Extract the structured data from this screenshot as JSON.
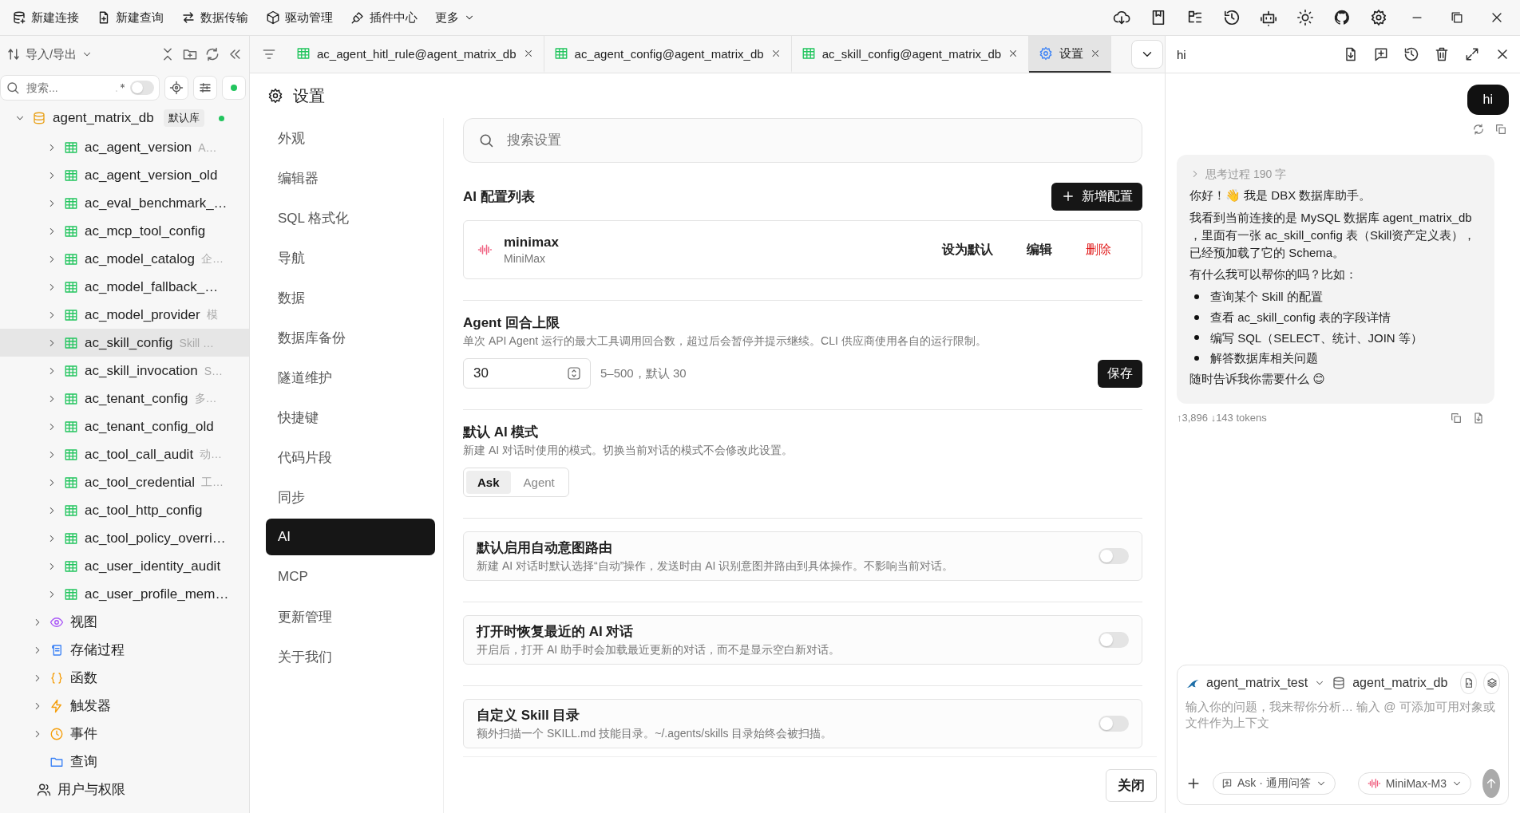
{
  "toolbar": {
    "actions": [
      {
        "label": "新建连接"
      },
      {
        "label": "新建查询"
      },
      {
        "label": "数据传输"
      },
      {
        "label": "驱动管理"
      },
      {
        "label": "插件中心"
      }
    ],
    "more": "更多"
  },
  "sidebar": {
    "import_export": "导入/导出",
    "search": {
      "placeholder": "搜索...",
      "regex_on": false
    },
    "tree": [
      {
        "label": "agent_matrix_db",
        "kind": "database",
        "badge": "默认库",
        "online": true,
        "expanded": true,
        "tables": [
          {
            "label": "ac_agent_version",
            "comment": "A…",
            "selected": false
          },
          {
            "label": "ac_agent_version_old",
            "selected": false
          },
          {
            "label": "ac_eval_benchmark_…",
            "selected": false
          },
          {
            "label": "ac_mcp_tool_config",
            "selected": false
          },
          {
            "label": "ac_model_catalog",
            "comment": "企…",
            "selected": false
          },
          {
            "label": "ac_model_fallback_…",
            "selected": false
          },
          {
            "label": "ac_model_provider",
            "comment": "模",
            "selected": false
          },
          {
            "label": "ac_skill_config",
            "comment": "Skill …",
            "selected": true
          },
          {
            "label": "ac_skill_invocation",
            "comment": "S…",
            "selected": false
          },
          {
            "label": "ac_tenant_config",
            "comment": "多…",
            "selected": false
          },
          {
            "label": "ac_tenant_config_old",
            "selected": false
          },
          {
            "label": "ac_tool_call_audit",
            "comment": "动…",
            "selected": false
          },
          {
            "label": "ac_tool_credential",
            "comment": "工…",
            "selected": false
          },
          {
            "label": "ac_tool_http_config",
            "selected": false
          },
          {
            "label": "ac_tool_policy_overri…",
            "selected": false
          },
          {
            "label": "ac_user_identity_audit",
            "selected": false
          },
          {
            "label": "ac_user_profile_mem…",
            "selected": false
          }
        ],
        "children": [
          {
            "label": "视图",
            "kind": "view",
            "expanded": false
          },
          {
            "label": "存储过程",
            "kind": "procedure",
            "expanded": false
          },
          {
            "label": "函数",
            "kind": "function",
            "expanded": false
          },
          {
            "label": "触发器",
            "kind": "trigger",
            "expanded": false
          },
          {
            "label": "事件",
            "kind": "event",
            "expanded": false
          },
          {
            "label": "查询",
            "kind": "folder"
          }
        ]
      },
      {
        "label": "用户与权限",
        "kind": "users"
      }
    ]
  },
  "tabs": [
    {
      "label": "ac_agent_hitl_rule@agent_matrix_db",
      "kind": "table",
      "selected": false
    },
    {
      "label": "ac_agent_config@agent_matrix_db",
      "kind": "table",
      "selected": false
    },
    {
      "label": "ac_skill_config@agent_matrix_db",
      "kind": "table",
      "selected": false
    },
    {
      "label": "设置",
      "kind": "settings",
      "selected": true
    }
  ],
  "settings": {
    "title": "设置",
    "nav": [
      {
        "label": "外观",
        "selected": false
      },
      {
        "label": "编辑器",
        "selected": false
      },
      {
        "label": "SQL 格式化",
        "selected": false
      },
      {
        "label": "导航",
        "selected": false
      },
      {
        "label": "数据",
        "selected": false
      },
      {
        "label": "数据库备份",
        "selected": false
      },
      {
        "label": "隧道维护",
        "selected": false
      },
      {
        "label": "快捷键",
        "selected": false
      },
      {
        "label": "代码片段",
        "selected": false
      },
      {
        "label": "同步",
        "selected": false
      },
      {
        "label": "AI",
        "selected": true
      },
      {
        "label": "MCP",
        "selected": false
      },
      {
        "label": "更新管理",
        "selected": false
      },
      {
        "label": "关于我们",
        "selected": false
      }
    ],
    "search": {
      "placeholder": "搜索设置"
    },
    "ai_configs": {
      "title": "AI 配置列表",
      "add_button": "新增配置",
      "items": [
        {
          "name": "minimax",
          "provider": "MiniMax",
          "actions": [
            {
              "label": "设为默认",
              "kind": "normal"
            },
            {
              "label": "编辑",
              "kind": "normal"
            },
            {
              "label": "删除",
              "kind": "danger"
            }
          ]
        }
      ]
    },
    "agent_limit": {
      "title": "Agent 回合上限",
      "description": "单次 API Agent 运行的最大工具调用回合数，超过后会暂停并提示继续。CLI 供应商使用各自的运行限制。",
      "value": "30",
      "hint": "5–500，默认 30",
      "save": "保存"
    },
    "default_mode": {
      "title": "默认 AI 模式",
      "description": "新建 AI 对话时使用的模式。切换当前对话的模式不会修改此设置。",
      "options": [
        {
          "label": "Ask",
          "selected": true
        },
        {
          "label": "Agent",
          "selected": false
        }
      ]
    },
    "toggles": [
      {
        "title": "默认启用自动意图路由",
        "description": "新建 AI 对话时默认选择“自动”操作，发送时由 AI 识别意图并路由到具体操作。不影响当前对话。",
        "on": false
      },
      {
        "title": "打开时恢复最近的 AI 对话",
        "description": "开启后，打开 AI 助手时会加载最近更新的对话，而不是显示空白新对话。",
        "on": false
      },
      {
        "title": "自定义 Skill 目录",
        "description": "额外扫描一个 SKILL.md 技能目录。~/.agents/skills 目录始终会被扫描。",
        "on": false
      }
    ],
    "close": "关闭"
  },
  "chat": {
    "title": "hi",
    "user_message": "hi",
    "reply": {
      "thinking": "思考过程",
      "thinking_count": "190 字",
      "expanded": false,
      "blocks": [
        {
          "kind": "p",
          "text": "你好！👋 我是 DBX 数据库助手。"
        },
        {
          "kind": "p",
          "text": "我看到当前连接的是 MySQL 数据库 agent_matrix_db ，里面有一张 ac_skill_config 表（Skill资产定义表），已经预加载了它的 Schema。"
        },
        {
          "kind": "p",
          "text": "有什么我可以帮你的吗？比如："
        },
        {
          "kind": "list",
          "items": [
            "查询某个 Skill 的配置",
            "查看 ac_skill_config 表的字段详情",
            "编写 SQL（SELECT、统计、JOIN 等）",
            "解答数据库相关问题"
          ]
        },
        {
          "kind": "p",
          "text": "随时告诉我你需要什么 😊"
        }
      ],
      "tokens": "↑3,896 ↓143 tokens"
    },
    "composer": {
      "connection": "agent_matrix_test",
      "database": "agent_matrix_db",
      "placeholder": "输入你的问题，我来帮你分析… 输入 @ 可添加可用对象或文件作为上下文",
      "mode": "Ask · 通用问答",
      "model": "MiniMax-M3"
    }
  }
}
